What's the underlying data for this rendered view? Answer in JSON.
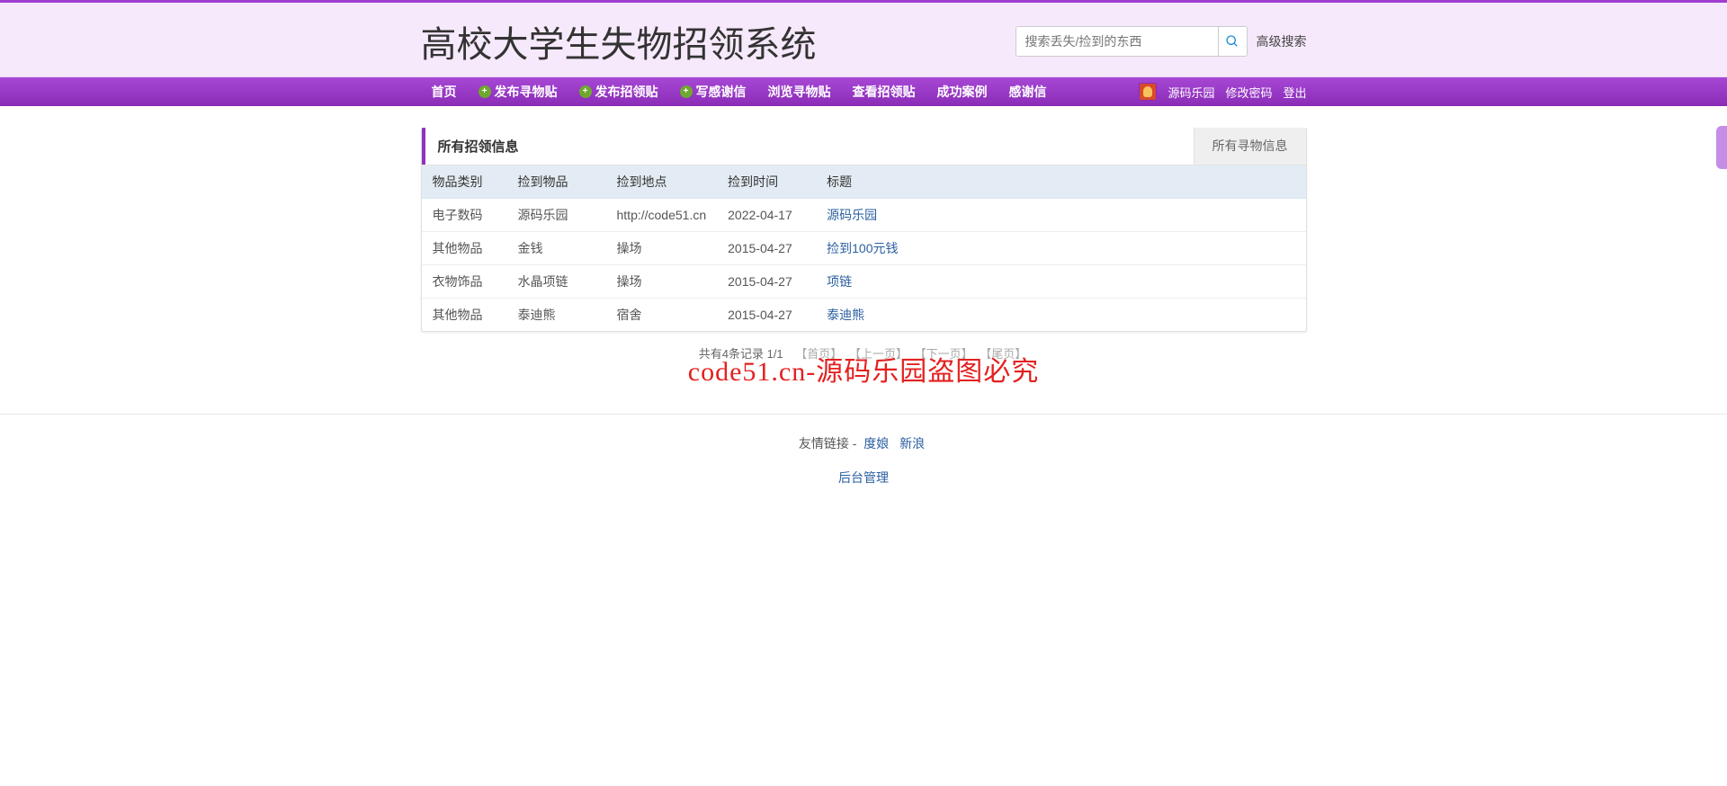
{
  "site_title": "高校大学生失物招领系统",
  "search": {
    "placeholder": "搜索丢失/捡到的东西",
    "advanced": "高级搜索"
  },
  "nav": {
    "items": [
      {
        "label": "首页",
        "plus": false
      },
      {
        "label": "发布寻物贴",
        "plus": true
      },
      {
        "label": "发布招领贴",
        "plus": true
      },
      {
        "label": "写感谢信",
        "plus": true
      },
      {
        "label": "浏览寻物贴",
        "plus": false
      },
      {
        "label": "查看招领贴",
        "plus": false
      },
      {
        "label": "成功案例",
        "plus": false
      },
      {
        "label": "感谢信",
        "plus": false
      }
    ],
    "right": {
      "username": "源码乐园",
      "change_pw": "修改密码",
      "logout": "登出"
    }
  },
  "panel": {
    "title": "所有招领信息",
    "right_tab": "所有寻物信息"
  },
  "table": {
    "headers": [
      "物品类别",
      "捡到物品",
      "捡到地点",
      "捡到时间",
      "标题"
    ],
    "rows": [
      {
        "cat": "电子数码",
        "item": "源码乐园",
        "loc": "http://code51.cn",
        "time": "2022-04-17",
        "title": "源码乐园"
      },
      {
        "cat": "其他物品",
        "item": "金钱",
        "loc": "操场",
        "time": "2015-04-27",
        "title": "捡到100元钱"
      },
      {
        "cat": "衣物饰品",
        "item": "水晶项链",
        "loc": "操场",
        "time": "2015-04-27",
        "title": "项链"
      },
      {
        "cat": "其他物品",
        "item": "泰迪熊",
        "loc": "宿舍",
        "time": "2015-04-27",
        "title": "泰迪熊"
      }
    ]
  },
  "pagination": {
    "summary": "共有4条记录  1/1",
    "first": "【首页】",
    "prev": "【上一页】",
    "next": "【下一页】",
    "last": "【尾页】"
  },
  "watermark": "code51.cn-源码乐园盗图必究",
  "footer": {
    "links_label": "友情链接 -",
    "link1": "度娘",
    "link2": "新浪",
    "admin": "后台管理"
  }
}
